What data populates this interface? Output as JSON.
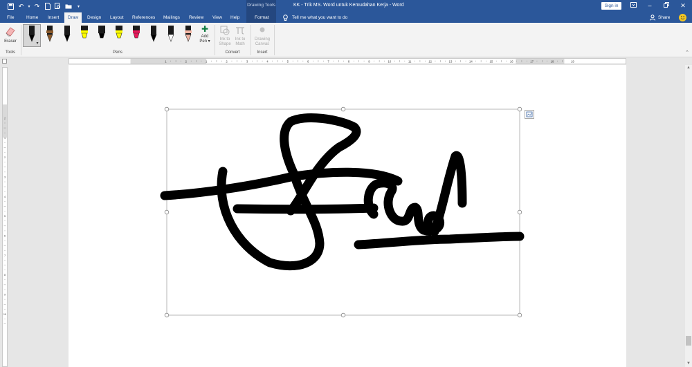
{
  "window": {
    "title": "KK - Trik MS. Word untuk Kemudahan Kerja  -  Word",
    "contextual_group": "Drawing Tools",
    "sign_in": "Sign in"
  },
  "quick_access": [
    "save-icon",
    "undo-icon",
    "redo-icon",
    "new-document-icon",
    "print-preview-icon",
    "open-folder-icon",
    "customize-icon"
  ],
  "tabs": [
    {
      "label": "File",
      "active": false
    },
    {
      "label": "Home",
      "active": false
    },
    {
      "label": "Insert",
      "active": false
    },
    {
      "label": "Draw",
      "active": true
    },
    {
      "label": "Design",
      "active": false
    },
    {
      "label": "Layout",
      "active": false
    },
    {
      "label": "References",
      "active": false
    },
    {
      "label": "Mailings",
      "active": false
    },
    {
      "label": "Review",
      "active": false
    },
    {
      "label": "View",
      "active": false
    },
    {
      "label": "Help",
      "active": false
    },
    {
      "label": "Format",
      "active": false
    }
  ],
  "tell_me": "Tell me what you want to do",
  "share": "Share",
  "ribbon": {
    "tools": {
      "label": "Tools",
      "eraser": "Eraser"
    },
    "pens": {
      "label": "Pens",
      "items": [
        {
          "kind": "pen",
          "color": "#000000",
          "selected": true
        },
        {
          "kind": "pencil",
          "color": "#8b5a2b"
        },
        {
          "kind": "pen",
          "color": "#000000"
        },
        {
          "kind": "highlighter",
          "color": "#ffff00"
        },
        {
          "kind": "marker",
          "color": "#000000"
        },
        {
          "kind": "highlighter",
          "color": "#ffff00"
        },
        {
          "kind": "highlighter",
          "color": "#e8185a"
        },
        {
          "kind": "pen",
          "color": "#000000"
        },
        {
          "kind": "pen",
          "color": "#ffffff"
        },
        {
          "kind": "pencil",
          "color": "#f2b6a5"
        }
      ],
      "add_pen": {
        "line1": "Add",
        "line2": "Pen ▾"
      }
    },
    "convert": {
      "label": "Convert",
      "ink_to_shape": {
        "line1": "Ink to",
        "line2": "Shape"
      },
      "ink_to_math": {
        "line1": "Ink to",
        "line2": "Math"
      }
    },
    "insert": {
      "label": "Insert",
      "drawing_canvas": {
        "line1": "Drawing",
        "line2": "Canvas"
      }
    }
  },
  "ruler": {
    "horizontal_ticks": [
      "1",
      "2",
      "1",
      "2",
      "3",
      "4",
      "5",
      "6",
      "7",
      "8",
      "9",
      "10",
      "11",
      "12",
      "13",
      "14",
      "15",
      "16",
      "17",
      "18",
      "19"
    ],
    "vertical_ticks": [
      "1",
      "2",
      "1",
      "2",
      "3",
      "4",
      "5",
      "6",
      "7",
      "8",
      "9",
      "10"
    ]
  },
  "colors": {
    "title_bar": "#2b579a",
    "ink": "#000000",
    "ribbon": "#f3f3f3"
  }
}
